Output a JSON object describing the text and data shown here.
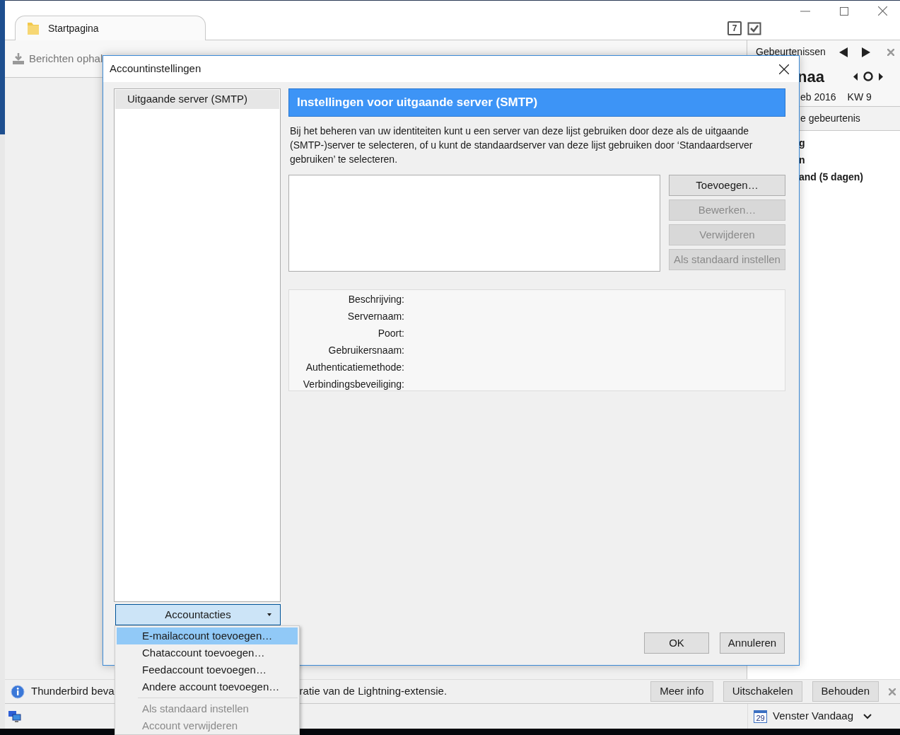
{
  "main_window": {
    "tab": {
      "label": "Startpagina",
      "selected": true
    },
    "calendar_icon_day": "7",
    "toolbar": {
      "get_messages": "Berichten ophal"
    }
  },
  "today_pane": {
    "title": "Gebeurtenissen",
    "day_name": "naa",
    "date": "eb 2016",
    "week": "KW 9",
    "new_event": "e gebeurtenis",
    "sections": [
      "g",
      "n",
      "and (5 dagen)"
    ]
  },
  "dialog": {
    "title": "Accountinstellingen",
    "accounts": [
      {
        "label": "Uitgaande server (SMTP)",
        "selected": true
      }
    ],
    "account_actions": "Accountacties",
    "panel_title": "Instellingen voor uitgaande server (SMTP)",
    "description": "Bij het beheren van uw identiteiten kunt u een server van deze lijst gebruiken door deze als de uitgaande (SMTP-)server te selecteren, of u kunt de standaardserver van deze lijst gebruiken door ‘Standaardserver gebruiken’ te selecteren.",
    "server_buttons": [
      {
        "label": "Toevoegen…",
        "disabled": false
      },
      {
        "label": "Bewerken…",
        "disabled": true
      },
      {
        "label": "Verwijderen",
        "disabled": true
      },
      {
        "label": "Als standaard instellen",
        "disabled": true
      }
    ],
    "details": [
      "Beschrijving:",
      "Servernaam:",
      "Poort:",
      "Gebruikersnaam:",
      "Authenticatiemethode:",
      "Verbindingsbeveiliging:"
    ],
    "buttons": [
      "OK",
      "Annuleren"
    ]
  },
  "menu": {
    "items": [
      {
        "kind": "item",
        "label": "E-mailaccount toevoegen…",
        "selected": true,
        "disabled": false
      },
      {
        "kind": "item",
        "label": "Chataccount toevoegen…",
        "selected": false,
        "disabled": false
      },
      {
        "kind": "item",
        "label": "Feedaccount toevoegen…",
        "selected": false,
        "disabled": false
      },
      {
        "kind": "item",
        "label": "Andere account toevoegen…",
        "selected": false,
        "disabled": false
      },
      {
        "kind": "separator"
      },
      {
        "kind": "item",
        "label": "Als standaard instellen",
        "selected": false,
        "disabled": true
      },
      {
        "kind": "item",
        "label": "Account verwijderen",
        "selected": false,
        "disabled": true
      }
    ]
  },
  "notification": {
    "text_start": "Thunderbird beva",
    "text_end": "ratie van de Lightning-extensie.",
    "buttons": [
      "Meer info",
      "Uitschakelen",
      "Behouden"
    ]
  },
  "status_bar": {
    "calendar_day": "29",
    "today_pane_toggle": "Venster Vandaag"
  }
}
